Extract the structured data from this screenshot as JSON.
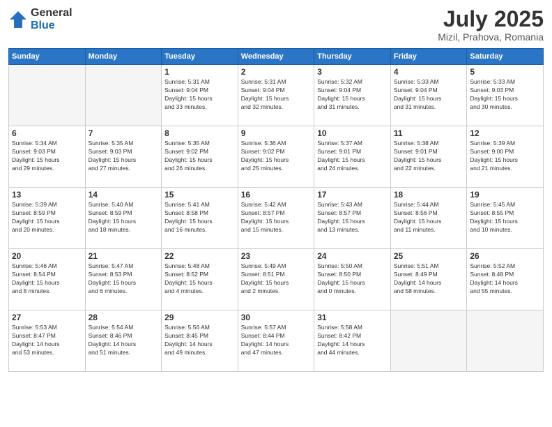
{
  "header": {
    "logo_general": "General",
    "logo_blue": "Blue",
    "title": "July 2025",
    "location": "Mizil, Prahova, Romania"
  },
  "weekdays": [
    "Sunday",
    "Monday",
    "Tuesday",
    "Wednesday",
    "Thursday",
    "Friday",
    "Saturday"
  ],
  "weeks": [
    [
      {
        "day": "",
        "info": ""
      },
      {
        "day": "",
        "info": ""
      },
      {
        "day": "1",
        "info": "Sunrise: 5:31 AM\nSunset: 9:04 PM\nDaylight: 15 hours\nand 33 minutes."
      },
      {
        "day": "2",
        "info": "Sunrise: 5:31 AM\nSunset: 9:04 PM\nDaylight: 15 hours\nand 32 minutes."
      },
      {
        "day": "3",
        "info": "Sunrise: 5:32 AM\nSunset: 9:04 PM\nDaylight: 15 hours\nand 31 minutes."
      },
      {
        "day": "4",
        "info": "Sunrise: 5:33 AM\nSunset: 9:04 PM\nDaylight: 15 hours\nand 31 minutes."
      },
      {
        "day": "5",
        "info": "Sunrise: 5:33 AM\nSunset: 9:03 PM\nDaylight: 15 hours\nand 30 minutes."
      }
    ],
    [
      {
        "day": "6",
        "info": "Sunrise: 5:34 AM\nSunset: 9:03 PM\nDaylight: 15 hours\nand 29 minutes."
      },
      {
        "day": "7",
        "info": "Sunrise: 5:35 AM\nSunset: 9:03 PM\nDaylight: 15 hours\nand 27 minutes."
      },
      {
        "day": "8",
        "info": "Sunrise: 5:35 AM\nSunset: 9:02 PM\nDaylight: 15 hours\nand 26 minutes."
      },
      {
        "day": "9",
        "info": "Sunrise: 5:36 AM\nSunset: 9:02 PM\nDaylight: 15 hours\nand 25 minutes."
      },
      {
        "day": "10",
        "info": "Sunrise: 5:37 AM\nSunset: 9:01 PM\nDaylight: 15 hours\nand 24 minutes."
      },
      {
        "day": "11",
        "info": "Sunrise: 5:38 AM\nSunset: 9:01 PM\nDaylight: 15 hours\nand 22 minutes."
      },
      {
        "day": "12",
        "info": "Sunrise: 5:39 AM\nSunset: 9:00 PM\nDaylight: 15 hours\nand 21 minutes."
      }
    ],
    [
      {
        "day": "13",
        "info": "Sunrise: 5:39 AM\nSunset: 8:59 PM\nDaylight: 15 hours\nand 20 minutes."
      },
      {
        "day": "14",
        "info": "Sunrise: 5:40 AM\nSunset: 8:59 PM\nDaylight: 15 hours\nand 18 minutes."
      },
      {
        "day": "15",
        "info": "Sunrise: 5:41 AM\nSunset: 8:58 PM\nDaylight: 15 hours\nand 16 minutes."
      },
      {
        "day": "16",
        "info": "Sunrise: 5:42 AM\nSunset: 8:57 PM\nDaylight: 15 hours\nand 15 minutes."
      },
      {
        "day": "17",
        "info": "Sunrise: 5:43 AM\nSunset: 8:57 PM\nDaylight: 15 hours\nand 13 minutes."
      },
      {
        "day": "18",
        "info": "Sunrise: 5:44 AM\nSunset: 8:56 PM\nDaylight: 15 hours\nand 11 minutes."
      },
      {
        "day": "19",
        "info": "Sunrise: 5:45 AM\nSunset: 8:55 PM\nDaylight: 15 hours\nand 10 minutes."
      }
    ],
    [
      {
        "day": "20",
        "info": "Sunrise: 5:46 AM\nSunset: 8:54 PM\nDaylight: 15 hours\nand 8 minutes."
      },
      {
        "day": "21",
        "info": "Sunrise: 5:47 AM\nSunset: 8:53 PM\nDaylight: 15 hours\nand 6 minutes."
      },
      {
        "day": "22",
        "info": "Sunrise: 5:48 AM\nSunset: 8:52 PM\nDaylight: 15 hours\nand 4 minutes."
      },
      {
        "day": "23",
        "info": "Sunrise: 5:49 AM\nSunset: 8:51 PM\nDaylight: 15 hours\nand 2 minutes."
      },
      {
        "day": "24",
        "info": "Sunrise: 5:50 AM\nSunset: 8:50 PM\nDaylight: 15 hours\nand 0 minutes."
      },
      {
        "day": "25",
        "info": "Sunrise: 5:51 AM\nSunset: 8:49 PM\nDaylight: 14 hours\nand 58 minutes."
      },
      {
        "day": "26",
        "info": "Sunrise: 5:52 AM\nSunset: 8:48 PM\nDaylight: 14 hours\nand 55 minutes."
      }
    ],
    [
      {
        "day": "27",
        "info": "Sunrise: 5:53 AM\nSunset: 8:47 PM\nDaylight: 14 hours\nand 53 minutes."
      },
      {
        "day": "28",
        "info": "Sunrise: 5:54 AM\nSunset: 8:46 PM\nDaylight: 14 hours\nand 51 minutes."
      },
      {
        "day": "29",
        "info": "Sunrise: 5:56 AM\nSunset: 8:45 PM\nDaylight: 14 hours\nand 49 minutes."
      },
      {
        "day": "30",
        "info": "Sunrise: 5:57 AM\nSunset: 8:44 PM\nDaylight: 14 hours\nand 47 minutes."
      },
      {
        "day": "31",
        "info": "Sunrise: 5:58 AM\nSunset: 8:42 PM\nDaylight: 14 hours\nand 44 minutes."
      },
      {
        "day": "",
        "info": ""
      },
      {
        "day": "",
        "info": ""
      }
    ]
  ]
}
